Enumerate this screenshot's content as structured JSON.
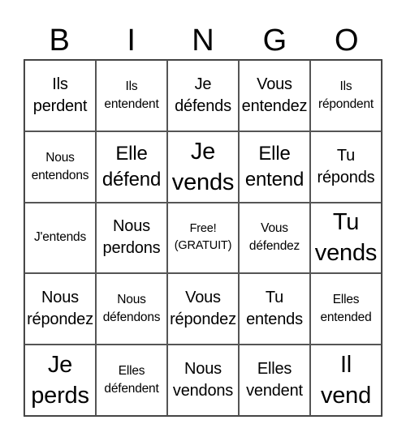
{
  "header": {
    "letters": [
      "B",
      "I",
      "N",
      "G",
      "O"
    ]
  },
  "card": {
    "rows": [
      [
        {
          "text": "Ils perdent",
          "size": "m"
        },
        {
          "text": "Ils entendent",
          "size": "s"
        },
        {
          "text": "Je défends",
          "size": "m"
        },
        {
          "text": "Vous entendez",
          "size": "m"
        },
        {
          "text": "Ils répondent",
          "size": "s"
        }
      ],
      [
        {
          "text": "Nous entendons",
          "size": "s"
        },
        {
          "text": "Elle défend",
          "size": "l"
        },
        {
          "text": "Je vends",
          "size": "xl"
        },
        {
          "text": "Elle entend",
          "size": "l"
        },
        {
          "text": "Tu réponds",
          "size": "m"
        }
      ],
      [
        {
          "text": "J'entends",
          "size": "s"
        },
        {
          "text": "Nous perdons",
          "size": "m"
        },
        {
          "text": "Free! (GRATUIT)",
          "size": "free"
        },
        {
          "text": "Vous défendez",
          "size": "s"
        },
        {
          "text": "Tu vends",
          "size": "xl"
        }
      ],
      [
        {
          "text": "Nous répondez",
          "size": "m"
        },
        {
          "text": "Nous défendons",
          "size": "s"
        },
        {
          "text": "Vous répondez",
          "size": "m"
        },
        {
          "text": "Tu entends",
          "size": "m"
        },
        {
          "text": "Elles entended",
          "size": "s"
        }
      ],
      [
        {
          "text": "Je perds",
          "size": "xl"
        },
        {
          "text": "Elles défendent",
          "size": "s"
        },
        {
          "text": "Nous vendons",
          "size": "m"
        },
        {
          "text": "Elles vendent",
          "size": "m"
        },
        {
          "text": "Il vend",
          "size": "xl"
        }
      ]
    ]
  }
}
